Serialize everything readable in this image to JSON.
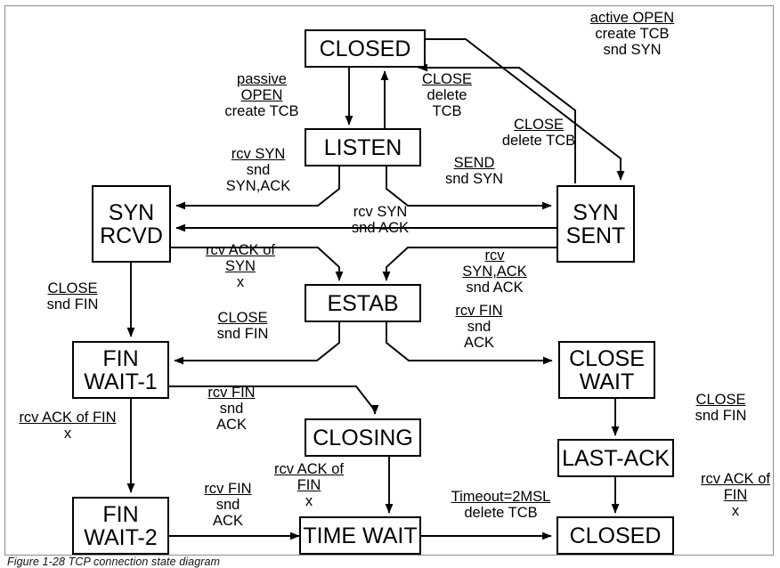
{
  "figure": {
    "caption": "Figure 1-28   TCP connection state diagram",
    "border_color": "#8a8a8a",
    "line_color": "#000000",
    "background": "#ffffff"
  },
  "states": [
    {
      "id": "closed-top",
      "name": "CLOSED",
      "lines": [
        "CLOSED"
      ]
    },
    {
      "id": "listen",
      "name": "LISTEN",
      "lines": [
        "LISTEN"
      ]
    },
    {
      "id": "syn-rcvd",
      "name": "SYN RCVD",
      "lines": [
        "SYN",
        "RCVD"
      ]
    },
    {
      "id": "syn-sent",
      "name": "SYN SENT",
      "lines": [
        "SYN",
        "SENT"
      ]
    },
    {
      "id": "estab",
      "name": "ESTAB",
      "lines": [
        "ESTAB"
      ]
    },
    {
      "id": "fin-wait-1",
      "name": "FIN WAIT-1",
      "lines": [
        "FIN",
        "WAIT-1"
      ]
    },
    {
      "id": "close-wait",
      "name": "CLOSE WAIT",
      "lines": [
        "CLOSE",
        "WAIT"
      ]
    },
    {
      "id": "closing",
      "name": "CLOSING",
      "lines": [
        "CLOSING"
      ]
    },
    {
      "id": "last-ack",
      "name": "LAST-ACK",
      "lines": [
        "LAST-ACK"
      ]
    },
    {
      "id": "fin-wait-2",
      "name": "FIN WAIT-2",
      "lines": [
        "FIN",
        "WAIT-2"
      ]
    },
    {
      "id": "time-wait",
      "name": "TIME WAIT",
      "lines": [
        "TIME WAIT"
      ]
    },
    {
      "id": "closed-bottom",
      "name": "CLOSED",
      "lines": [
        "CLOSED"
      ]
    }
  ],
  "transitions": [
    {
      "id": "active-open",
      "event": "active OPEN",
      "actions": [
        "create TCB",
        "snd SYN"
      ]
    },
    {
      "id": "passive-open",
      "event": "passive OPEN",
      "event_lines": [
        "passive",
        "OPEN"
      ],
      "actions": [
        "create TCB"
      ]
    },
    {
      "id": "close-delete-tcb-1",
      "event": "CLOSE",
      "actions": [
        "delete",
        "TCB"
      ]
    },
    {
      "id": "close-delete-tcb-2",
      "event": "CLOSE",
      "actions": [
        "delete TCB"
      ]
    },
    {
      "id": "rcv-syn-snd-synack",
      "event": "rcv SYN",
      "actions": [
        "snd",
        "SYN,ACK"
      ]
    },
    {
      "id": "send-snd-syn",
      "event": "SEND",
      "actions": [
        "snd SYN"
      ]
    },
    {
      "id": "rcv-syn-snd-ack",
      "event": "rcv SYN",
      "actions": [
        "snd ACK"
      ],
      "underlined": false
    },
    {
      "id": "rcv-ack-of-syn",
      "event": "rcv ACK of SYN",
      "event_lines": [
        "rcv ACK of",
        "SYN"
      ],
      "actions": [
        "x"
      ],
      "underlined": false
    },
    {
      "id": "rcv-synack-snd-ack",
      "event": "rcv SYN,ACK",
      "event_lines": [
        "rcv",
        "SYN,ACK"
      ],
      "actions": [
        "snd ACK"
      ]
    },
    {
      "id": "close-snd-fin-1",
      "event": "CLOSE",
      "actions": [
        "snd FIN"
      ]
    },
    {
      "id": "close-snd-fin-2",
      "event": "CLOSE",
      "actions": [
        "snd FIN"
      ]
    },
    {
      "id": "rcv-fin-snd-ack-1",
      "event": "rcv FIN",
      "actions": [
        "snd",
        "ACK"
      ]
    },
    {
      "id": "rcv-fin-snd-ack-2",
      "event": "rcv FIN",
      "actions": [
        "snd",
        "ACK"
      ]
    },
    {
      "id": "rcv-fin-snd-ack-3",
      "event": "rcv FIN",
      "actions": [
        "snd",
        "ACK"
      ]
    },
    {
      "id": "rcv-ack-of-fin-1",
      "event": "rcv ACK of FIN",
      "actions": [
        "x"
      ]
    },
    {
      "id": "rcv-ack-of-fin-2",
      "event": "rcv ACK of FIN",
      "event_lines": [
        "rcv ACK of",
        "FIN"
      ],
      "actions": [
        "x"
      ]
    },
    {
      "id": "rcv-ack-of-fin-3",
      "event": "rcv ACK of FIN",
      "event_lines": [
        "rcv ACK of",
        "FIN"
      ],
      "actions": [
        "x"
      ]
    },
    {
      "id": "close-snd-fin-3",
      "event": "CLOSE",
      "actions": [
        "snd FIN"
      ]
    },
    {
      "id": "timeout-2msl",
      "event": "Timeout=2MSL",
      "actions": [
        "delete TCB"
      ]
    }
  ],
  "labels": {
    "active_open": {
      "l1": "active OPEN",
      "l2": "create TCB",
      "l3": "snd SYN"
    },
    "passive_open": {
      "l1": "passive",
      "l2": "OPEN",
      "l3": "create TCB"
    },
    "close_delete_tcb_a": {
      "l1": "CLOSE",
      "l2": "delete",
      "l3": "TCB"
    },
    "close_delete_tcb_b": {
      "l1": "CLOSE",
      "l2": "delete TCB"
    },
    "rcv_syn_snd_synack": {
      "l1": "rcv SYN",
      "l2": "snd",
      "l3": "SYN,ACK"
    },
    "send_snd_syn": {
      "l1": "SEND",
      "l2": "snd SYN"
    },
    "rcv_syn_snd_ack": {
      "l1": "rcv SYN",
      "l2": "snd ACK"
    },
    "rcv_ack_of_syn": {
      "l1": "rcv ACK of",
      "l2": "SYN",
      "l3": "x"
    },
    "rcv_synack_snd_ack": {
      "l1": "rcv",
      "l2": "SYN,ACK",
      "l3": "snd ACK"
    },
    "close_snd_fin_left": {
      "l1": "CLOSE",
      "l2": "snd FIN"
    },
    "close_snd_fin_mid": {
      "l1": "CLOSE",
      "l2": "snd FIN"
    },
    "close_snd_fin_right": {
      "l1": "CLOSE",
      "l2": "snd FIN"
    },
    "rcv_fin_snd_ack_r": {
      "l1": "rcv FIN",
      "l2": "snd",
      "l3": "ACK"
    },
    "rcv_fin_snd_ack_m": {
      "l1": "rcv FIN",
      "l2": "snd",
      "l3": "ACK"
    },
    "rcv_fin_snd_ack_b": {
      "l1": "rcv FIN",
      "l2": "snd",
      "l3": "ACK"
    },
    "rcv_ack_of_fin_l": {
      "l1": "rcv ACK of FIN",
      "l2": "x"
    },
    "rcv_ack_of_fin_m": {
      "l1": "rcv ACK of",
      "l2": "FIN",
      "l3": "x"
    },
    "rcv_ack_of_fin_r": {
      "l1": "rcv ACK of",
      "l2": "FIN",
      "l3": "x"
    },
    "timeout_2msl": {
      "l1": "Timeout=2MSL",
      "l2": "delete TCB"
    }
  }
}
